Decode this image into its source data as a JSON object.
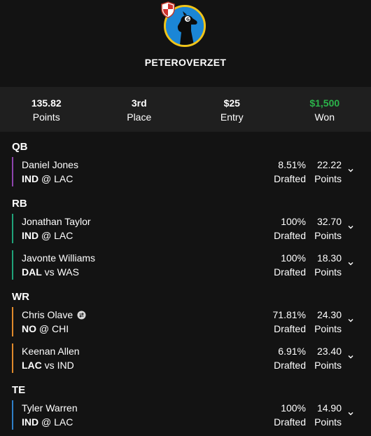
{
  "user": {
    "username": "PETEROVERZET",
    "avatar_icon": "dog-icon",
    "badge_icon": "shield-icon",
    "avatar_bg": "#1b86d6",
    "avatar_ring": "#f0c419"
  },
  "stats": {
    "points_value": "135.82",
    "points_label": "Points",
    "place_value": "3rd",
    "place_label": "Place",
    "entry_value": "$25",
    "entry_label": "Entry",
    "won_value": "$1,500",
    "won_label": "Won",
    "won_color": "#2bb34a"
  },
  "labels": {
    "drafted": "Drafted",
    "points": "Points"
  },
  "sections": [
    {
      "label": "QB",
      "color": "#8e44ad"
    },
    {
      "label": "RB",
      "color": "#1fa37a"
    },
    {
      "label": "WR",
      "color": "#e08a2b"
    },
    {
      "label": "TE",
      "color": "#2f7fc9"
    }
  ],
  "players": [
    {
      "name": "Daniel Jones",
      "team": "IND",
      "sep": "@",
      "opp": "LAC",
      "drafted": "8.51%",
      "points": "22.22"
    },
    {
      "name": "Jonathan Taylor",
      "team": "IND",
      "sep": "@",
      "opp": "LAC",
      "drafted": "100%",
      "points": "32.70"
    },
    {
      "name": "Javonte Williams",
      "team": "DAL",
      "sep": "vs",
      "opp": "WAS",
      "drafted": "100%",
      "points": "18.30"
    },
    {
      "name": "Chris Olave",
      "team": "NO",
      "sep": "@",
      "opp": "CHI",
      "drafted": "71.81%",
      "points": "24.30",
      "swap_icon": "swap-icon"
    },
    {
      "name": "Keenan Allen",
      "team": "LAC",
      "sep": "vs",
      "opp": "IND",
      "drafted": "6.91%",
      "points": "23.40"
    },
    {
      "name": "Tyler Warren",
      "team": "IND",
      "sep": "@",
      "opp": "LAC",
      "drafted": "100%",
      "points": "14.90"
    }
  ]
}
